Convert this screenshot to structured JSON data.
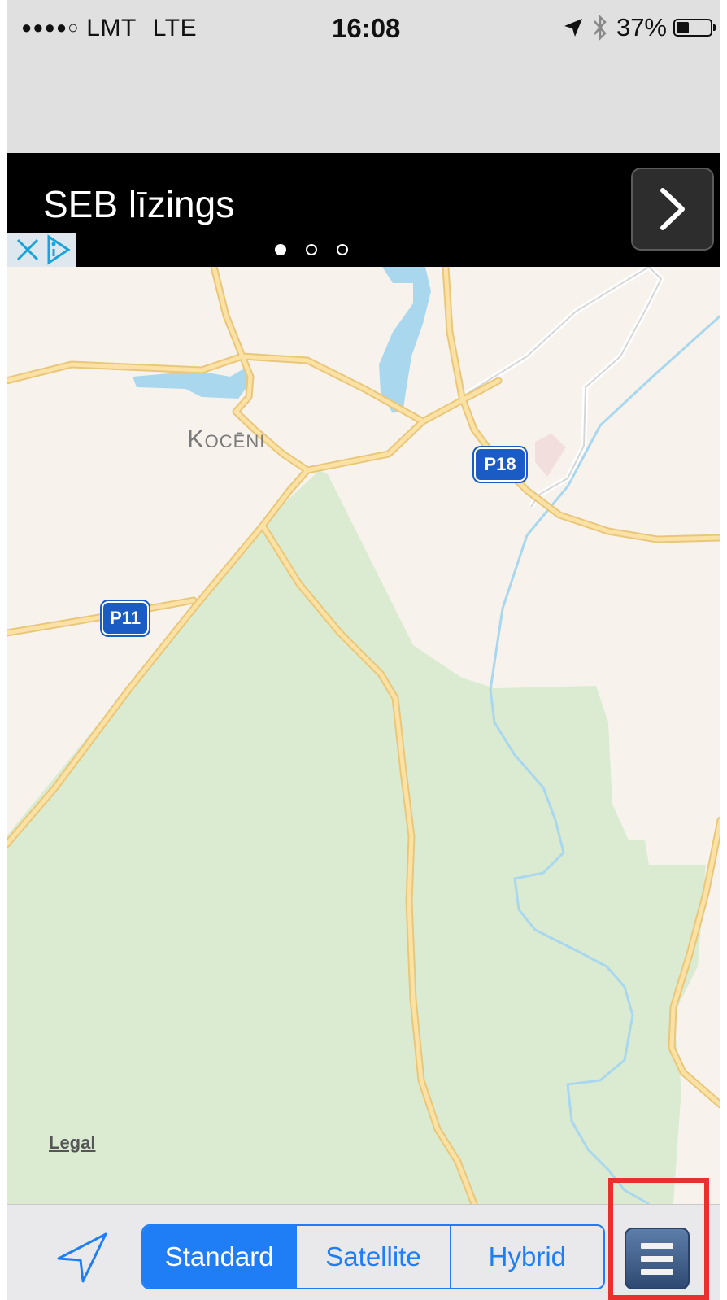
{
  "status_bar": {
    "signal_dots": "●●●●○",
    "carrier": "LMT",
    "network": "LTE",
    "time": "16:08",
    "battery_percent": "37%",
    "battery_level": 0.37,
    "location_icon": "location-arrow-icon",
    "bluetooth_icon": "bluetooth-icon"
  },
  "ad_banner": {
    "title": "SEB līzings",
    "page_count": 3,
    "active_page": 1,
    "arrow_icon": "chevron-right-icon",
    "close_icon": "close-icon",
    "adchoices_icon": "adchoices-icon"
  },
  "map": {
    "place_label": "Kocēni",
    "road_labels": [
      "P18",
      "P11"
    ],
    "legal_label": "Legal",
    "colors": {
      "land": "#f7f3ec",
      "forest": "#dbebd2",
      "water": "#a9d7ee",
      "road": "#f9d98c",
      "shield": "#1a5bc4"
    }
  },
  "toolbar": {
    "locate_icon": "location-arrow-icon",
    "map_types": [
      "Standard",
      "Satellite",
      "Hybrid"
    ],
    "selected_map_type": "Standard",
    "menu_icon": "menu-icon",
    "accent_color": "#1f7ef5"
  }
}
